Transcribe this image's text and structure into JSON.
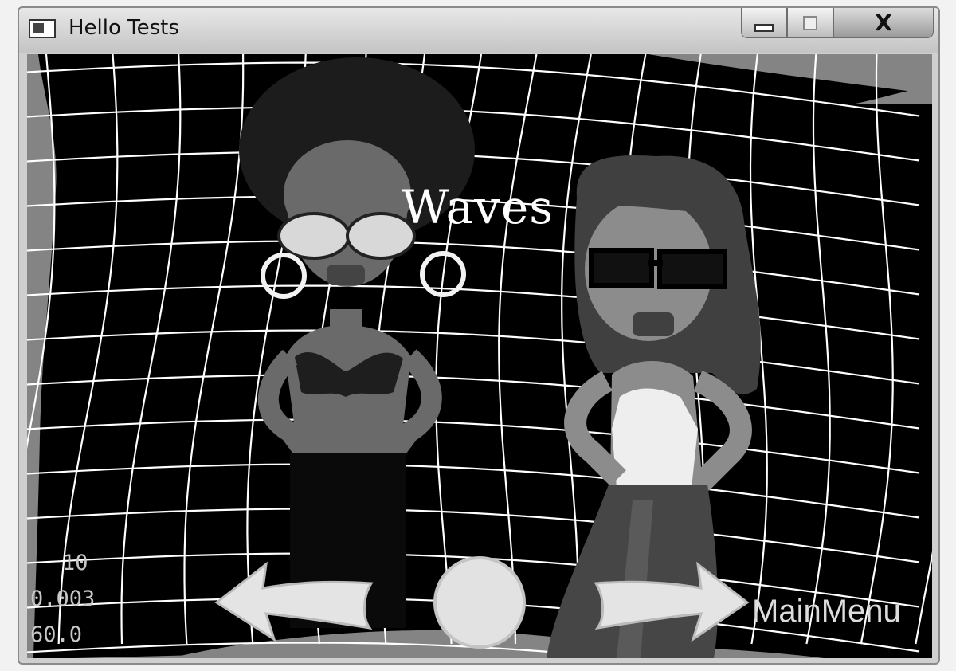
{
  "window": {
    "title": "Hello Tests",
    "close_label": "X"
  },
  "scene": {
    "title": "Waves",
    "characters": [
      "afro-girl-sprite",
      "brunette-girl-sprite"
    ],
    "grid_effect": "waves"
  },
  "stats": {
    "line1": "10",
    "line2": "0.003",
    "line3": "60.0"
  },
  "controls": {
    "prev_icon": "left-arrow-icon",
    "restart_icon": "circle-button-icon",
    "next_icon": "right-arrow-icon",
    "menu_label": "MainMenu"
  },
  "colors": {
    "background": "#000000",
    "grid": "#ffffff",
    "text": "#ffffff"
  }
}
